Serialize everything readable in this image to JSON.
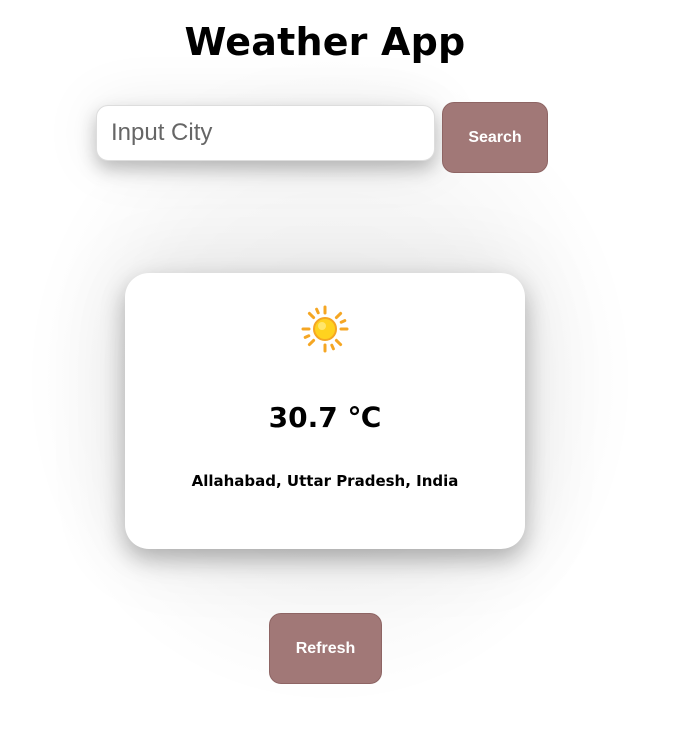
{
  "app": {
    "title": "Weather App"
  },
  "search": {
    "placeholder": "Input City",
    "value": "",
    "button_label": "Search"
  },
  "weather": {
    "icon": "sun-icon",
    "temperature": "30.7 ℃",
    "location": "Allahabad, Uttar Pradesh, India"
  },
  "actions": {
    "refresh_label": "Refresh"
  },
  "colors": {
    "button_bg": "#a17877",
    "button_text": "#ffffff",
    "sun": "#ffcc00"
  }
}
